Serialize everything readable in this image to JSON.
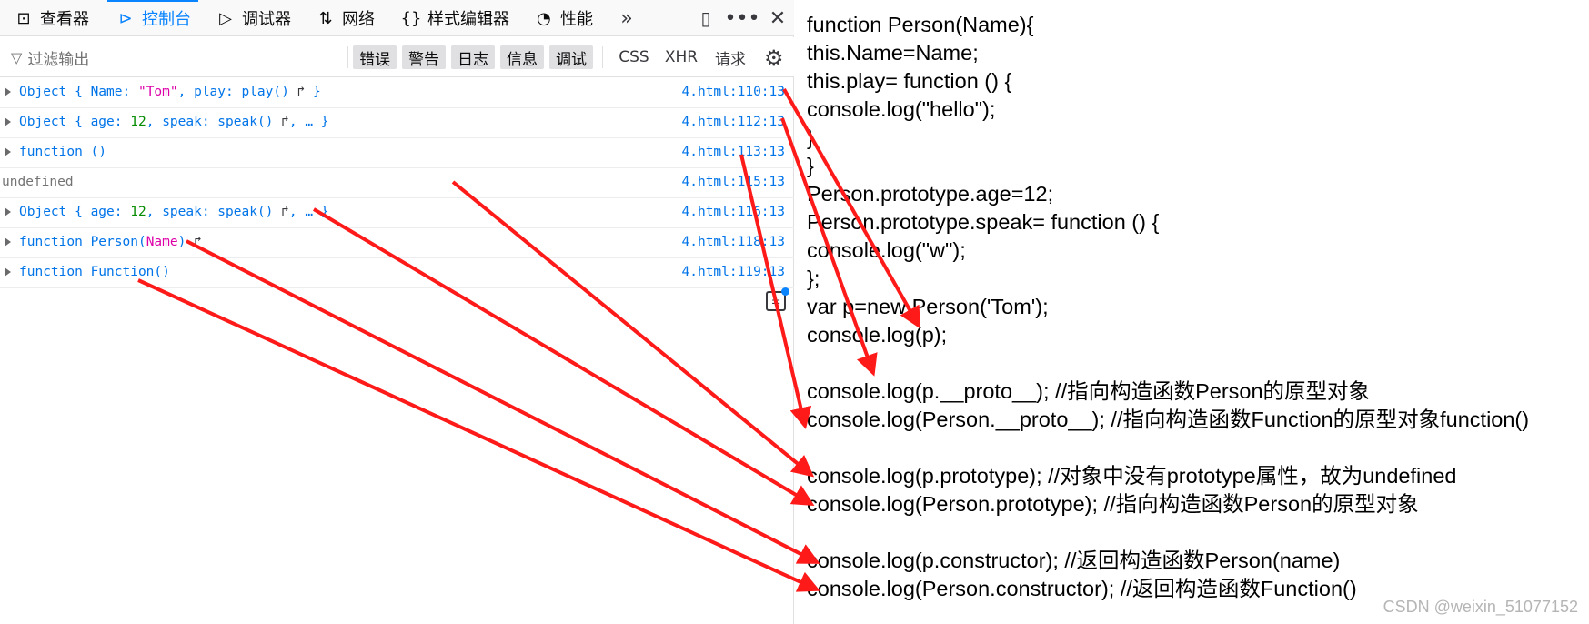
{
  "toolbar": {
    "tabs": [
      {
        "label": "查看器",
        "icon": "inspector-icon"
      },
      {
        "label": "控制台",
        "icon": "console-icon"
      },
      {
        "label": "调试器",
        "icon": "debugger-icon"
      },
      {
        "label": "网络",
        "icon": "network-icon"
      },
      {
        "label": "样式编辑器",
        "icon": "style-editor-icon"
      },
      {
        "label": "性能",
        "icon": "performance-icon"
      }
    ],
    "active_tab": "控制台",
    "accent": "#0a84ff"
  },
  "filter": {
    "placeholder": "过滤输出",
    "levels": [
      "错误",
      "警告",
      "日志",
      "信息",
      "调试"
    ],
    "types": [
      "CSS",
      "XHR",
      "请求"
    ]
  },
  "console": {
    "rows": [
      {
        "parts": [
          "Object { ",
          "Name",
          ": ",
          "\"Tom\"",
          ", ",
          "play",
          ": play() ",
          "↱",
          " }"
        ],
        "location": "4.html:110:13"
      },
      {
        "parts": [
          "Object { ",
          "age",
          ": ",
          "12",
          ", ",
          "speak",
          ": speak() ",
          "↱",
          ", … }"
        ],
        "location": "4.html:112:13"
      },
      {
        "text": "function ()",
        "location": "4.html:113:13"
      },
      {
        "text": "undefined",
        "location": "4.html:115:13"
      },
      {
        "parts": [
          "Object { ",
          "age",
          ": ",
          "12",
          ", ",
          "speak",
          ": speak() ",
          "↱",
          ", … }"
        ],
        "location": "4.html:116:13"
      },
      {
        "parts": [
          "function Person(",
          "Name",
          ") ",
          "↱"
        ],
        "location": "4.html:118:13"
      },
      {
        "text": "function Function()",
        "location": "4.html:119:13"
      }
    ]
  },
  "code": {
    "lines": [
      "function Person(Name){",
      "this.Name=Name;",
      "this.play= function () {",
      "console.log(\"hello\");",
      "}",
      "}",
      "Person.prototype.age=12;",
      "Person.prototype.speak= function () {",
      "console.log(\"w\");",
      "};",
      "var p=new Person('Tom');",
      "console.log(p);",
      "",
      "console.log(p.__proto__); //指向构造函数Person的原型对象",
      "console.log(Person.__proto__); //指向构造函数Function的原型对象function()",
      "",
      "console.log(p.prototype); //对象中没有prototype属性，故为undefined",
      "console.log(Person.prototype); //指向构造函数Person的原型对象",
      "",
      "console.log(p.constructor); //返回构造函数Person(name)",
      "console.log(Person.constructor); //返回构造函数Function()"
    ]
  },
  "watermark": "CSDN @weixin_51077152",
  "annotation_color": "#ff1a1a"
}
